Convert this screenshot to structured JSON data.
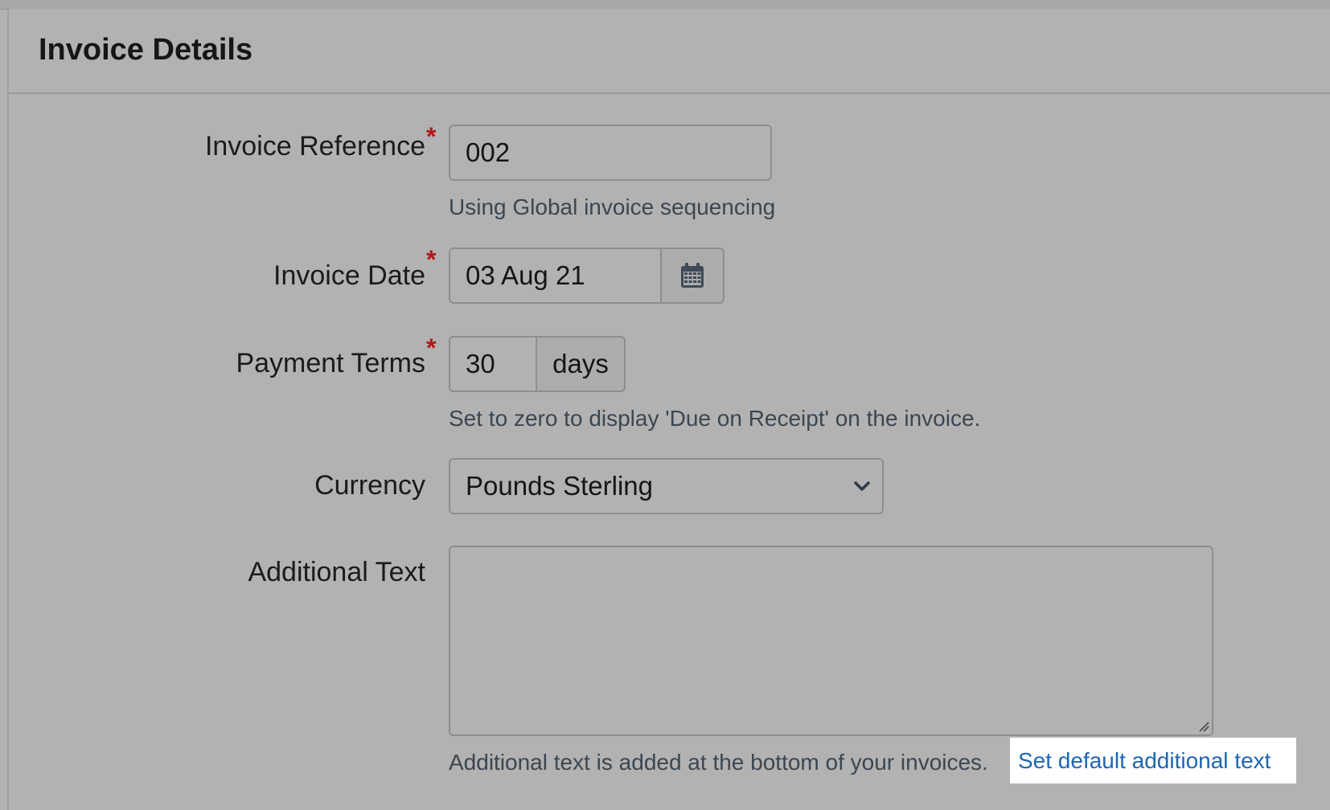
{
  "panel": {
    "title": "Invoice Details"
  },
  "form": {
    "invoice_reference": {
      "label": "Invoice Reference",
      "required_marker": "*",
      "value": "002",
      "help": "Using Global invoice sequencing"
    },
    "invoice_date": {
      "label": "Invoice Date",
      "required_marker": "*",
      "value": "03 Aug 21",
      "icon": "calendar-icon"
    },
    "payment_terms": {
      "label": "Payment Terms",
      "required_marker": "*",
      "value": "30",
      "unit": "days",
      "help": "Set to zero to display 'Due on Receipt' on the invoice."
    },
    "currency": {
      "label": "Currency",
      "selected": "Pounds Sterling",
      "icon": "chevron-down-icon"
    },
    "additional_text": {
      "label": "Additional Text",
      "value": "",
      "help": "Additional text is added at the bottom of your invoices.",
      "link": "Set default additional text"
    }
  },
  "colors": {
    "background": "#b2b2b2",
    "required": "#b3161a",
    "link": "#1e66b0",
    "help_text": "#3c4650",
    "highlight": "#ffffff"
  }
}
